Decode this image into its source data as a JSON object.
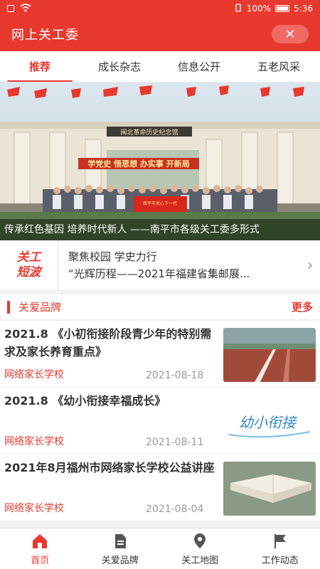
{
  "status": {
    "battery": "100%",
    "time": "5:36"
  },
  "app": {
    "title": "网上关工委",
    "close_label": "✕"
  },
  "tabs": [
    {
      "label": "推荐",
      "active": true
    },
    {
      "label": "成长杂志"
    },
    {
      "label": "信息公开"
    },
    {
      "label": "五老风采"
    }
  ],
  "banner": {
    "caption": "传承红色基因 培养时代新人 ——南平市各级关工委多形式",
    "building_sign": "闽北革命历史纪念馆",
    "slogan": "学党史 悟思想 办实事 开新局",
    "flag_text": "南平市关心下一代"
  },
  "news": {
    "logo_line1": "关工",
    "logo_line2": "短波",
    "line1": "聚焦校园 学史力行",
    "line2": "“光辉历程——2021年福建省集邮展..."
  },
  "section": {
    "title": "关爱品牌",
    "more": "更多"
  },
  "items": [
    {
      "title": "2021.8 《小初衔接阶段青少年的特别需求及家长养育重点》",
      "source": "网络家长学校",
      "date": "2021-08-18",
      "thumb": "track"
    },
    {
      "title": "2021.8 《幼小衔接幸福成长》",
      "source": "网络家长学校",
      "date": "2021-08-11",
      "thumb": "text",
      "thumb_text": "幼小衔接"
    },
    {
      "title": "2021年8月福州市网络家长学校公益讲座",
      "source": "网络家长学校",
      "date": "2021-08-04",
      "thumb": "book"
    }
  ],
  "bottom_nav": [
    {
      "label": "首页",
      "icon": "home-icon",
      "active": true
    },
    {
      "label": "关爱品牌",
      "icon": "document-icon"
    },
    {
      "label": "关工地图",
      "icon": "map-pin-icon"
    },
    {
      "label": "工作动态",
      "icon": "flag-icon"
    }
  ],
  "colors": {
    "accent": "#e8392f"
  }
}
